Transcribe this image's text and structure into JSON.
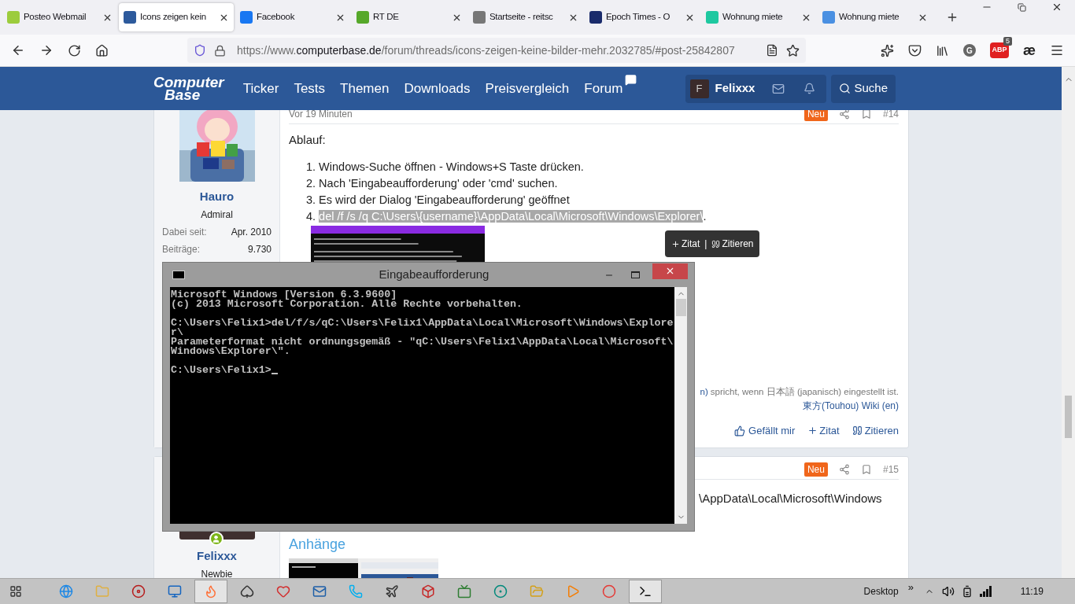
{
  "browser": {
    "tabs": [
      {
        "label": "Posteo Webmail",
        "selected": false
      },
      {
        "label": "Icons zeigen kein",
        "selected": true
      },
      {
        "label": "Facebook",
        "selected": false
      },
      {
        "label": "RT DE",
        "selected": false
      },
      {
        "label": "Startseite - reitsc",
        "selected": false
      },
      {
        "label": "Epoch Times - O",
        "selected": false
      },
      {
        "label": "Wohnung miete",
        "selected": false
      },
      {
        "label": "Wohnung miete",
        "selected": false
      }
    ],
    "url": {
      "scheme": "https://www.",
      "domain": "computerbase.de",
      "path": "/forum/threads/icons-zeigen-keine-bilder-mehr.2032785/#post-25842807"
    },
    "account_initial": "G",
    "adblock_label": "ABP",
    "adblock_count": "5",
    "ae_label": "æ"
  },
  "site": {
    "logo": [
      "Computer",
      "Base"
    ],
    "nav": [
      "Ticker",
      "Tests",
      "Themen",
      "Downloads",
      "Preisvergleich",
      "Forum"
    ],
    "user_initial": "F",
    "username": "Felixxx",
    "search": "Suche"
  },
  "posts": [
    {
      "author": "Hauro",
      "rank": "Admiral",
      "stats": [
        {
          "label": "Dabei seit:",
          "value": "Apr. 2010"
        },
        {
          "label": "Beiträge:",
          "value": "9.730"
        }
      ],
      "time": "Vor 19 Minuten",
      "badge": "Neu",
      "number": "#14",
      "intro": "Ablauf:",
      "steps": [
        {
          "number": "1.",
          "text": "Windows-Suche öffnen - Windows+S Taste drücken.",
          "highlighted": false
        },
        {
          "number": "2.",
          "text": "Nach 'Eingabeaufforderung' oder 'cmd' suchen.",
          "highlighted": false
        },
        {
          "number": "3.",
          "text": "Es wird der Dialog 'Eingabeaufforderung' geöffnet",
          "highlighted": false
        },
        {
          "number": "4.",
          "text": "del /f /s /q C:\\Users\\{username}\\AppData\\Local\\Microsoft\\Windows\\Explorer\\",
          "trailing": ".",
          "highlighted": true
        }
      ],
      "signature_link": "n)",
      "signature_text": "spricht, wenn 日本語 (japanisch) eingestellt ist.",
      "signature_link2": "東方(Touhou) Wiki (en)",
      "actions": [
        "Gefällt mir",
        "Zitat",
        "Zitieren"
      ]
    },
    {
      "author": "Felixxx",
      "rank": "Newbie",
      "online": true,
      "badge": "Neu",
      "number": "#15",
      "text": "\\AppData\\Local\\Microsoft\\Windows",
      "attachments_title": "Anhänge"
    }
  ],
  "quote_tooltip": {
    "items": [
      "Zitat",
      "Zitieren"
    ],
    "separator": "|"
  },
  "console": {
    "title": "Eingabeaufforderung",
    "blocks": [
      [
        "Microsoft Windows [Version 6.3.9600]",
        "(c) 2013 Microsoft Corporation. Alle Rechte vorbehalten."
      ],
      [
        "C:\\Users\\Felix1>del/f/s/qC:\\Users\\Felix1\\AppData\\Local\\Microsoft\\Windows\\Explore",
        "r\\",
        "Parameterformat nicht ordnungsgemäß - \"qC:\\Users\\Felix1\\AppData\\Local\\Microsoft\\",
        "Windows\\Explorer\\\"."
      ],
      [
        "C:\\Users\\Felix1>"
      ]
    ],
    "cursor": true
  },
  "taskbar": {
    "apps": [
      {
        "active": false
      },
      {
        "active": false
      },
      {
        "active": false
      },
      {
        "active": false
      },
      {
        "active": true
      },
      {
        "active": false
      },
      {
        "active": false
      },
      {
        "active": false
      },
      {
        "active": false
      },
      {
        "active": false
      },
      {
        "active": false
      },
      {
        "active": false
      },
      {
        "active": false
      },
      {
        "active": false
      },
      {
        "active": false
      },
      {
        "active": false
      },
      {
        "active": true
      }
    ],
    "toolbar": "Desktop",
    "chevron": "»",
    "clock": "11:19"
  }
}
